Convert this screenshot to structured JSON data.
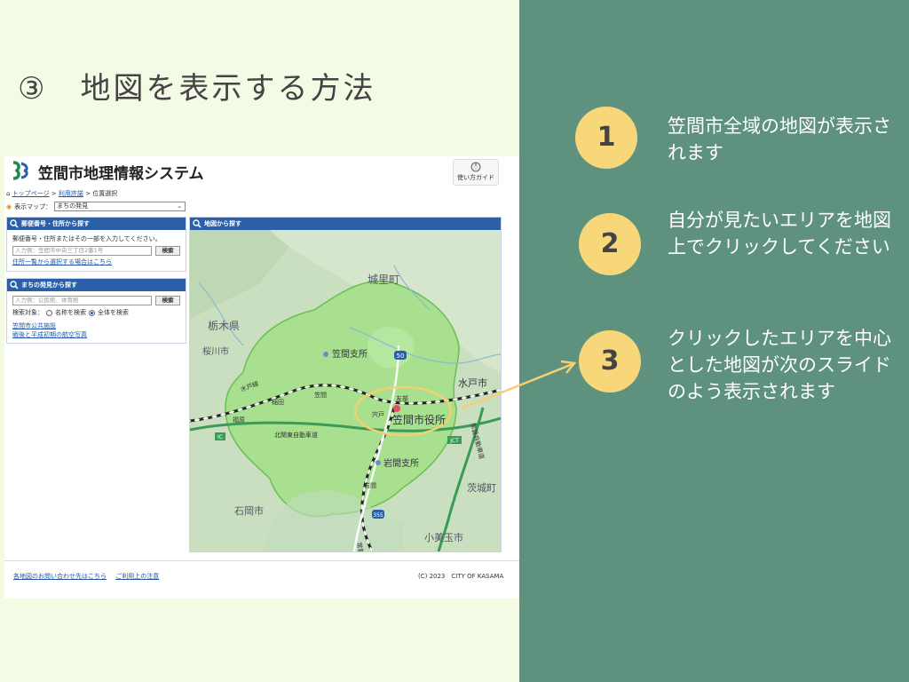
{
  "slide": {
    "title": "③　地図を表示する方法"
  },
  "site": {
    "title": "笠間市地理情報システム",
    "guide_label": "使い方ガイド",
    "breadcrumb": {
      "top": "トップページ",
      "sep1": " > ",
      "service": "利用許諾",
      "sep2": " > ",
      "current": "位置選択"
    },
    "map_select": {
      "label": "表示マップ：",
      "value": "まちの発見"
    },
    "postal_panel": {
      "header": "郵便番号・住所から探す",
      "instruction": "郵便番号・住所またはその一部を入力してください。",
      "placeholder": "入力例：笠間市中央三丁目2番1号",
      "search_button": "検索",
      "link": "住所一覧から選択する場合はこちら"
    },
    "facility_panel": {
      "header": "まちの発見から探す",
      "placeholder": "入力例：公民館、体育館",
      "search_button": "検索",
      "target_label": "検索対象：",
      "option_name": "名称を検索",
      "option_all": "全体を検索",
      "links": [
        "笠間市公共施設",
        "戦後と平成初期の航空写真"
      ]
    },
    "map_panel": {
      "header": "地図から探す",
      "labels": {
        "shirosato": "城里町",
        "tochigi": "栃木県",
        "sakuragawa": "桜川市",
        "kasama_branch": "笠間支所",
        "mito": "水戸市",
        "kasama_city": "笠間市役所",
        "iwama_branch": "岩間支所",
        "ibaraki": "茨城町",
        "ishioka": "石岡市",
        "omitama": "小美玉市",
        "inada": "稲田",
        "kasama_st": "笠間",
        "shishido": "宍戸",
        "tomobe": "友部",
        "iwama_st": "岩間",
        "fukuhara": "福原",
        "mito_line": "水戸線",
        "joban_line": "常磐線",
        "kitakanto": "北関東自動車道",
        "joban_exp": "常磐自動車道",
        "r50": "50",
        "r355": "355",
        "ic": "IC",
        "jct": "JCT"
      }
    },
    "footer": {
      "contact": "各地図のお問い合わせ先はこちら",
      "terms": "ご利用上の注意",
      "copyright": "(C) 2023　CITY OF KASAMA"
    }
  },
  "steps": [
    {
      "number": "1",
      "text": "笠間市全域の地図が表示されます"
    },
    {
      "number": "2",
      "text": "自分が見たいエリアを地図上でクリックしてください"
    },
    {
      "number": "3",
      "text": "クリックしたエリアを中心とした地図が次のスライドのよう表示されます"
    }
  ],
  "colors": {
    "right_panel": "#5e927f",
    "left_panel": "#f4fbe5",
    "step_circle": "#f8d77b",
    "arrow": "#f5cf72",
    "panel_header": "#2b5fa8"
  }
}
